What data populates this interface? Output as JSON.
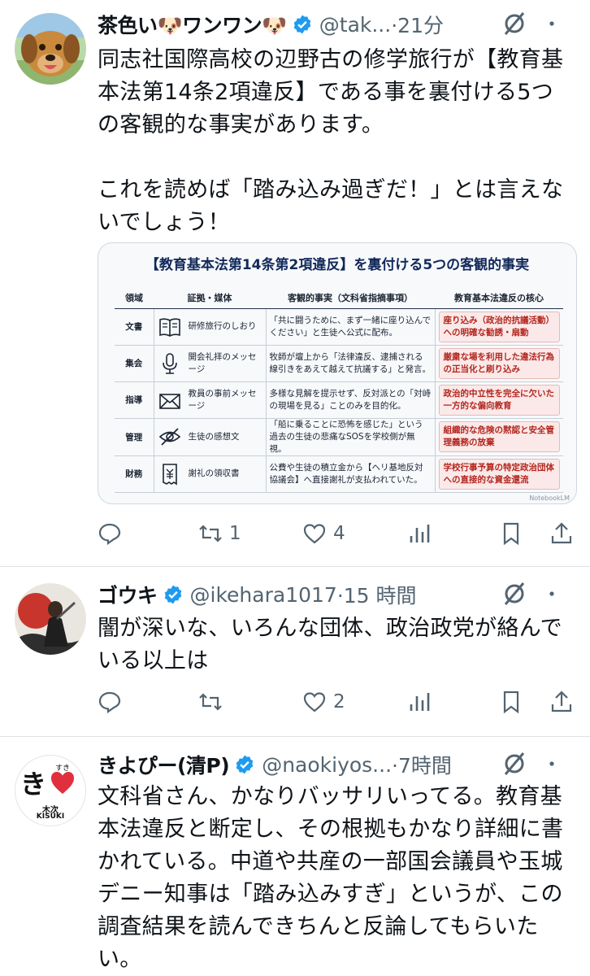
{
  "posts": [
    {
      "name": "茶色い🐶ワンワン🐶",
      "handle": "@tak...",
      "time": "·21分",
      "text": "同志社国際高校の辺野古の修学旅行が【教育基本法第14条2項違反】である事を裏付ける5つの客観的な事実があります。\n\nこれを読めば「踏み込み過ぎだ！」とは言えないでしょう！",
      "replies": "",
      "reposts": "1",
      "likes": "4"
    },
    {
      "name": "ゴウキ",
      "handle": "@ikehara1017",
      "time": "·15 時間",
      "text": "闇が深いな、いろんな団体、政治政党が絡んでいる以上は",
      "replies": "",
      "reposts": "",
      "likes": "2"
    },
    {
      "name": "きよぴー(清P)",
      "handle": "@naokiyos...",
      "time": "·7時間",
      "text": "文科省さん、かなりバッサリいってる。教育基本法違反と断定し、その根拠もかなり詳細に書かれている。中道や共産の一部国会議員や玉城デニー知事は「踏み込みすぎ」というが、この調査結果を読んできちんと反論してもらいたい。",
      "avatar_text": {
        "main": "き",
        "furigana": "すき",
        "bottom": "木次",
        "roman": "KISUKI"
      }
    }
  ],
  "card": {
    "title": "【教育基本法第14条第2項違反】を裏付ける5つの客観的事実",
    "headers": [
      "領域",
      "証拠・媒体",
      "客観的事実（文科省指摘事項）",
      "教育基本法違反の核心"
    ],
    "rows": [
      {
        "area": "文書",
        "icon": "book-icon",
        "evidence": "研修旅行のしおり",
        "fact": "「共に闘うために、まず一緒に座り込んでください」と生徒へ公式に配布。",
        "core": "座り込み（政治的抗議活動）への明確な勧誘・扇動"
      },
      {
        "area": "集会",
        "icon": "microphone-icon",
        "evidence": "開会礼拝のメッセージ",
        "fact": "牧師が壇上から「法律違反、逮捕される線引きをあえて越えて抗議する」と発言。",
        "core": "厳粛な場を利用した違法行為の正当化と刷り込み"
      },
      {
        "area": "指導",
        "icon": "envelope-icon",
        "evidence": "教員の事前メッセージ",
        "fact": "多様な見解を提示せず、反対派との「対峙の現場を見る」ことのみを目的化。",
        "core": "政治的中立性を完全に欠いた一方的な偏向教育"
      },
      {
        "area": "管理",
        "icon": "eye-slash-icon",
        "evidence": "生徒の感想文",
        "fact": "「船に乗ることに恐怖を感じた」という過去の生徒の悲痛なSOSを学校側が無視。",
        "core": "組織的な危険の黙認と安全管理義務の放棄"
      },
      {
        "area": "財務",
        "icon": "receipt-icon",
        "evidence": "謝礼の領収書",
        "fact": "公費や生徒の積立金から【ヘリ基地反対協議会】へ直接謝礼が支払われていた。",
        "core": "学校行事予算の特定政治団体への直接的な資金還流"
      }
    ],
    "footer": "NotebookLM"
  },
  "colors": {
    "verified": "#1d9bf0",
    "text": "#0f1419",
    "muted": "#536471",
    "heart": "#e0303d"
  }
}
